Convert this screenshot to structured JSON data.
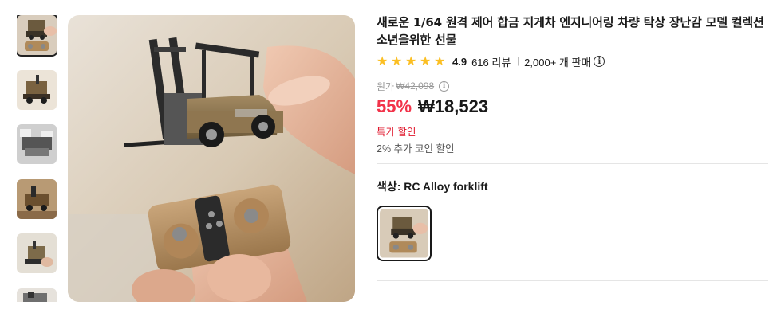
{
  "product": {
    "title": "새로운 1/64 원격 제어 합금 지게차 엔지니어링 차량 탁상 장난감 모델 컬렉션 소년을위한 선물",
    "rating": "4.9",
    "review_count": "616 리뷰",
    "separator": "|",
    "sold": "2,000+ 개 판매",
    "info_icon": "i",
    "original_label": "원가",
    "original_price": "₩42,098",
    "discount": "55%",
    "price": "₩18,523",
    "deal_label": "특가 할인",
    "coin_label": "2% 추가 코인 할인",
    "color_label": "색상: RC Alloy forklift",
    "star_color": "#fbbf24",
    "discount_color": "#f2334a"
  },
  "thumbnails": [
    {
      "name": "thumb-1",
      "active": true
    },
    {
      "name": "thumb-2",
      "active": false
    },
    {
      "name": "thumb-3",
      "active": false
    },
    {
      "name": "thumb-4",
      "active": false
    },
    {
      "name": "thumb-5",
      "active": false
    },
    {
      "name": "thumb-6",
      "active": false
    }
  ],
  "icons": {
    "star": "star-icon",
    "info": "info-icon"
  }
}
